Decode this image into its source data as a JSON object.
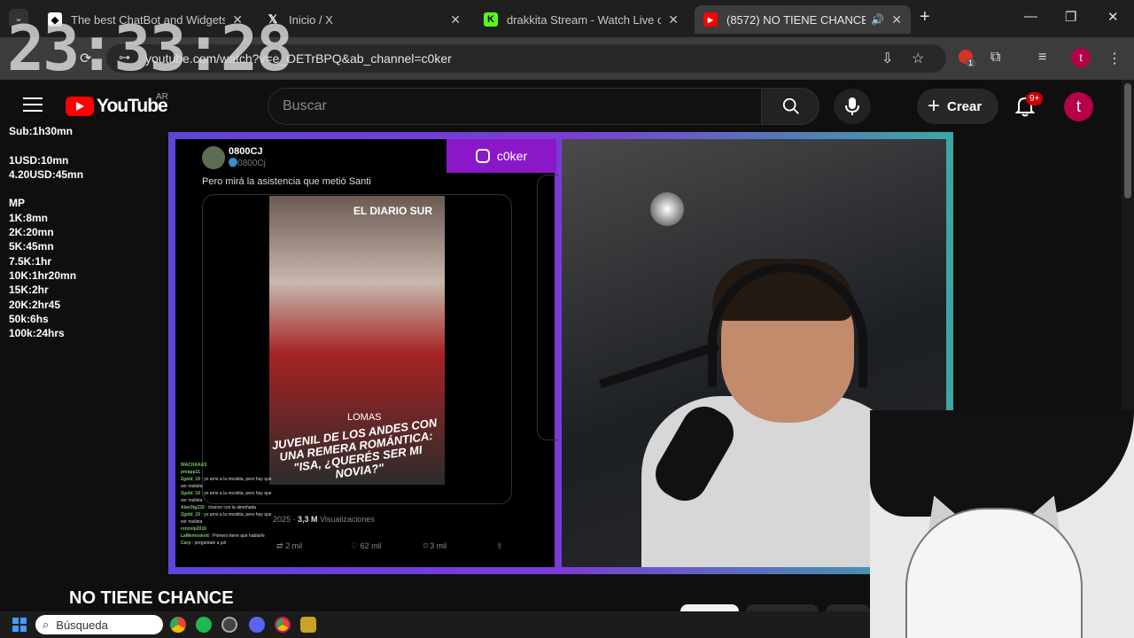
{
  "browser": {
    "tabs": [
      {
        "title": "The best ChatBot and Widgets",
        "favicon": "chatbot-icon",
        "active": false
      },
      {
        "title": "Inicio / X",
        "favicon": "x-icon",
        "active": false
      },
      {
        "title": "drakkita Stream - Watch Live on",
        "favicon": "kick-icon",
        "active": false
      },
      {
        "title": "(8572) NO TIENE CHANCE",
        "favicon": "youtube-icon",
        "active": true
      }
    ],
    "url": "youtube.com/watch?v=e_OETrBPQ&ab_channel=c0ker",
    "extension_badge": "1",
    "profile_initial": "t"
  },
  "clock": "23:33:28",
  "youtube": {
    "logo_text": "YouTube",
    "country": "AR",
    "search_placeholder": "Buscar",
    "create_label": "Crear",
    "notif_badge": "9+",
    "avatar_initial": "t",
    "video_title": "NO TIENE CHANCE"
  },
  "goals": [
    "Sub:1h30mn",
    "",
    "1USD:10mn",
    "4.20USD:45mn",
    "",
    "MP",
    "1K:8mn",
    "2K:20mn",
    "5K:45mn",
    "7.5K:1hr",
    "10K:1hr20mn",
    "15K:2hr",
    "20K:2hr45",
    "50k:6hs",
    "100k:24hrs"
  ],
  "tweet": {
    "name": "0800CJ",
    "handle": "@0800Cj",
    "text": "Pero mirá la asistencia que metió Santi",
    "video_brand": "EL DIARIO SUR",
    "video_location": "LOMAS",
    "video_headline": "JUVENIL DE LOS ANDES CON UNA REMERA ROMÁNTICA: \"ISA, ¿QUERÉS SER MI NOVIA?\"",
    "year": "2025",
    "views": "3,3 M",
    "views_label": "Visualizaciones",
    "replies": "2 mil",
    "likes": "62 mil",
    "bookmarks": "3 mil"
  },
  "instagram_handle": "c0ker",
  "chat": [
    {
      "user": "WACHAAAS",
      "msg": ""
    },
    {
      "user": "jmrapp11",
      "msg": ""
    },
    {
      "user": "Zgold_19",
      "msg": ": yo amo a la moskita, pero hay que ser realista"
    },
    {
      "user": "Zgold_19",
      "msg": ": yo amo a la moskita, pero hay que ser realista"
    },
    {
      "user": "Alan3tg233",
      "msg": ": chance con la almohada"
    },
    {
      "user": "Zgold_19",
      "msg": ": yo amo a la moskita, pero hay que ser realista"
    },
    {
      "user": "renzolp2016",
      "msg": ""
    },
    {
      "user": "LaMemoskett",
      "msg": ": Primero tiene que hablarle"
    },
    {
      "user": "Carp",
      "msg": ": pregúntale a juli"
    }
  ],
  "taskbar": {
    "search_placeholder": "Búsqueda"
  },
  "colors": {
    "yt_red": "#ff0000",
    "instagram_purple": "#8a18c9",
    "avatar": "#b5004a"
  }
}
